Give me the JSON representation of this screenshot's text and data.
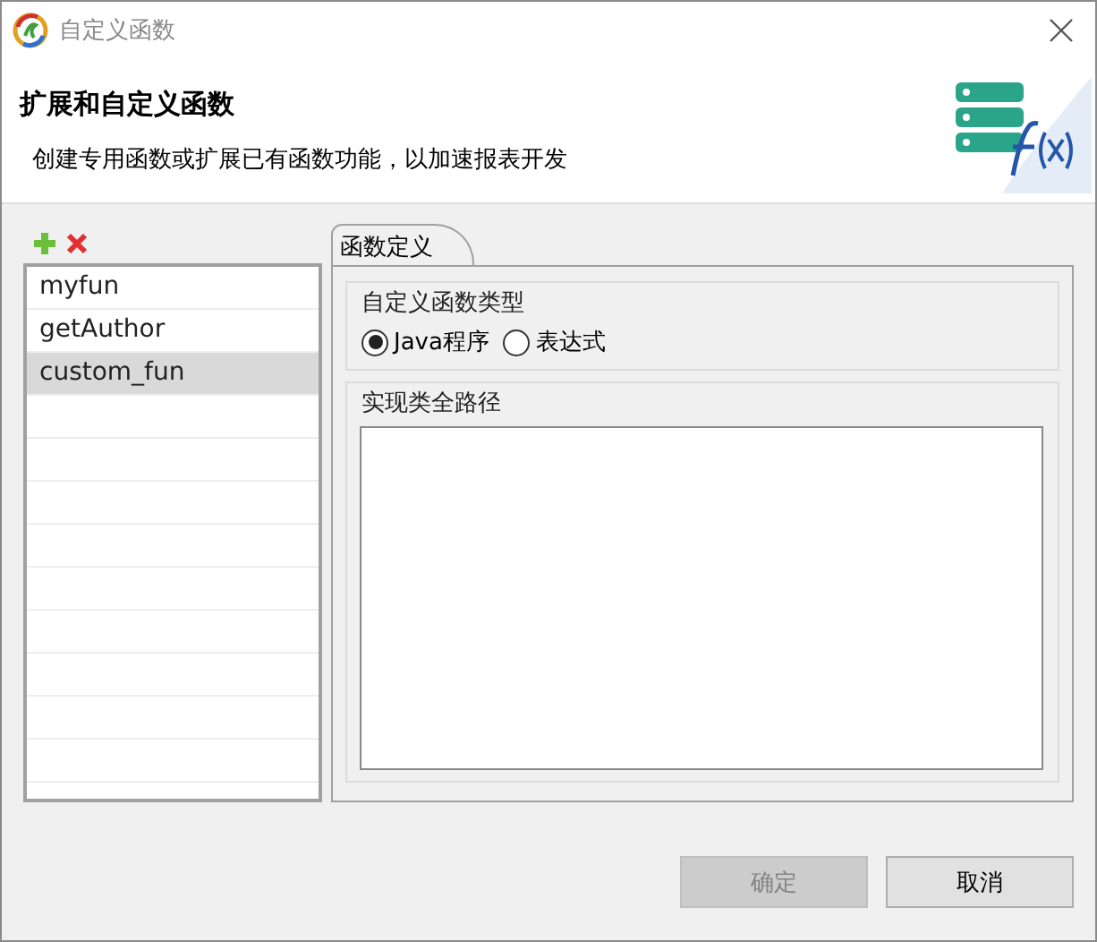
{
  "window": {
    "title": "自定义函数"
  },
  "header": {
    "title": "扩展和自定义函数",
    "description": "创建专用函数或扩展已有函数功能，以加速报表开发"
  },
  "function_list": {
    "items": [
      {
        "label": "myfun",
        "selected": false
      },
      {
        "label": "getAuthor",
        "selected": false
      },
      {
        "label": "custom_fun",
        "selected": true
      }
    ]
  },
  "tabs": [
    {
      "label": "函数定义",
      "selected": true
    }
  ],
  "type_group": {
    "title": "自定义函数类型",
    "options": [
      {
        "label": "Java程序",
        "selected": true
      },
      {
        "label": "表达式",
        "selected": false
      }
    ]
  },
  "path_group": {
    "title": "实现类全路径"
  },
  "buttons": [
    {
      "label": "确定",
      "disabled": true
    },
    {
      "label": "取消",
      "disabled": false
    }
  ]
}
